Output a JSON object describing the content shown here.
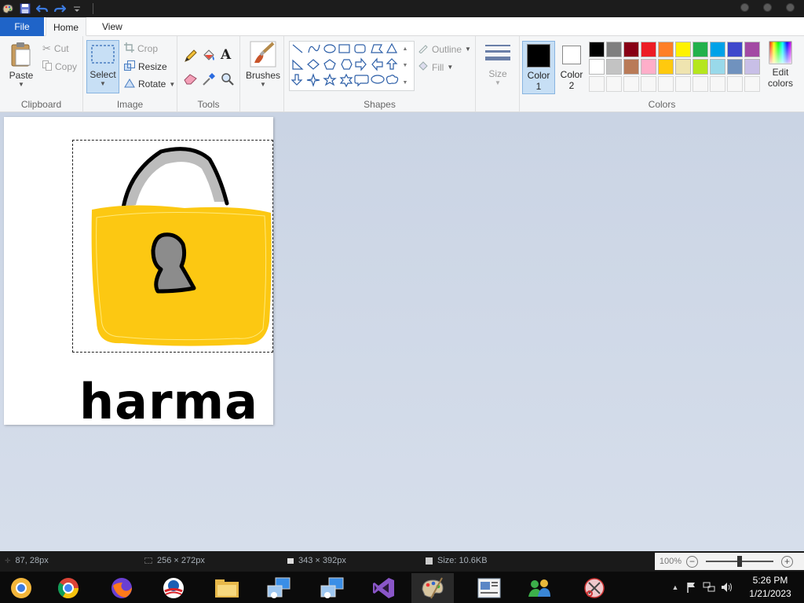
{
  "ribbon_tabs": {
    "file": "File",
    "home": "Home",
    "view": "View"
  },
  "clipboard": {
    "paste": "Paste",
    "cut": "Cut",
    "copy": "Copy",
    "label": "Clipboard"
  },
  "image": {
    "select": "Select",
    "crop": "Crop",
    "resize": "Resize",
    "rotate": "Rotate",
    "label": "Image"
  },
  "tools": {
    "label": "Tools",
    "items": [
      "pencil-icon",
      "fill-bucket-icon",
      "text-icon",
      "eraser-icon",
      "color-picker-icon",
      "magnifier-icon"
    ]
  },
  "brushes": {
    "label": "Brushes"
  },
  "shapes": {
    "label": "Shapes",
    "outline": "Outline",
    "fill": "Fill"
  },
  "size": {
    "label": "Size"
  },
  "colors": {
    "label": "Colors",
    "color1_label": "Color",
    "color1_num": "1",
    "color2_label": "Color",
    "color2_num": "2",
    "edit_label": "Edit",
    "edit_label2": "colors",
    "color1": "#000000",
    "color2": "#ffffff",
    "palette_row1": [
      "#000000",
      "#7f7f7f",
      "#880015",
      "#ed1c24",
      "#ff7f27",
      "#fff200",
      "#22b14c",
      "#00a2e8",
      "#3f48cc",
      "#a349a4"
    ],
    "palette_row2": [
      "#ffffff",
      "#c3c3c3",
      "#b97a57",
      "#ffaec9",
      "#ffc90e",
      "#efe4b0",
      "#b5e61d",
      "#99d9ea",
      "#7092be",
      "#c8bfe7"
    ]
  },
  "canvas": {
    "drawn_text": "harma",
    "lock_body_color": "#fcc812",
    "lock_shackle_color": "#bcbcbc",
    "keyhole_color": "#8c8c8c"
  },
  "status": {
    "cursor_pos": "87, 28px",
    "selection_size": "256 × 272px",
    "image_size": "343 × 392px",
    "file_size": "Size: 10.6KB",
    "zoom": "100%"
  },
  "taskbar": {
    "apps": [
      "chrome-canary-icon",
      "chrome-icon",
      "firefox-icon",
      "campaign-logo-icon",
      "file-explorer-icon",
      "remote-desktop-icon",
      "remote-desktop-icon",
      "visual-studio-icon",
      "paint-icon",
      "document-viewer-icon",
      "people-icon",
      "snipping-tool-icon"
    ],
    "time": "5:26 PM",
    "date": "1/21/2023"
  }
}
